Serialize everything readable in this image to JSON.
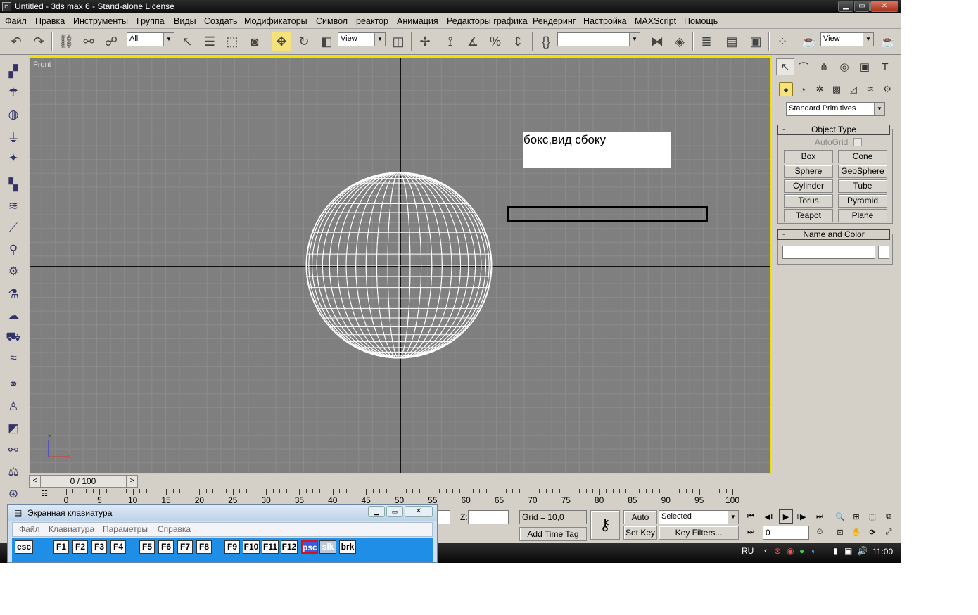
{
  "window": {
    "title": "Untitled - 3ds max 6 - Stand-alone License",
    "icon_text": "◘"
  },
  "menu": [
    "Файл",
    "Правка",
    "Инструменты",
    "Группа",
    "Виды",
    "Создать",
    "Модификаторы",
    "Символ",
    "реактор",
    "Анимация",
    "Редакторы графика",
    "Рендеринг",
    "Настройка",
    "MAXScript",
    "Помощь"
  ],
  "toolbar": {
    "selection_filter": "All",
    "ref_coord": "View",
    "named_selection": "",
    "render_view": "View"
  },
  "viewport": {
    "label": "Front",
    "note_text": "бокс,вид сбоку",
    "gizmo_z": "z",
    "gizmo_x": "x"
  },
  "command_panel": {
    "category": "Standard Primitives",
    "object_type_title": "Object Type",
    "autogrid_label": "AutoGrid",
    "buttons": [
      "Box",
      "Cone",
      "Sphere",
      "GeoSphere",
      "Cylinder",
      "Tube",
      "Torus",
      "Pyramid",
      "Teapot",
      "Plane"
    ],
    "name_color_title": "Name and Color",
    "name_value": ""
  },
  "timeline": {
    "frame_display": "0 / 100",
    "ticks": [
      "0",
      "5",
      "10",
      "15",
      "20",
      "25",
      "30",
      "35",
      "40",
      "45",
      "50",
      "55",
      "60",
      "65",
      "70",
      "75",
      "80",
      "85",
      "90",
      "95",
      "100"
    ]
  },
  "status": {
    "z_label": "Z:",
    "z_value": "",
    "grid": "Grid = 10,0",
    "add_time_tag": "Add Time Tag",
    "auto_key": "Auto Key",
    "set_key": "Set Key",
    "key_mode": "Selected",
    "key_filters": "Key Filters...",
    "frame": "0"
  },
  "taskbar": {
    "lang": "RU",
    "clock": "11:00"
  },
  "osk": {
    "title": "Экранная клавиатура",
    "menu": [
      "Файл",
      "Клавиатура",
      "Параметры",
      "Справка"
    ],
    "keys": [
      "esc",
      "F1",
      "F2",
      "F3",
      "F4",
      "F5",
      "F6",
      "F7",
      "F8",
      "F9",
      "F10",
      "F11",
      "F12",
      "psc",
      "slk",
      "brk"
    ]
  }
}
